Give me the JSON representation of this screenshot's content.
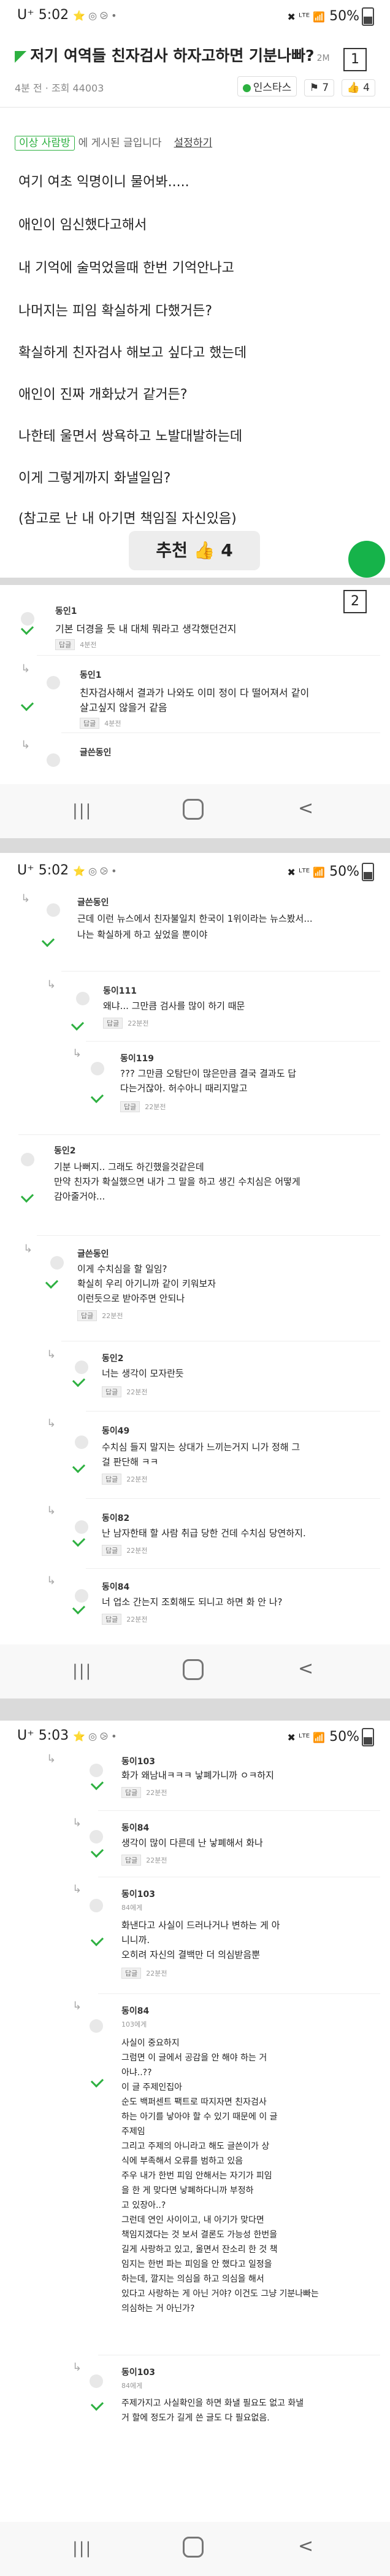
{
  "status_bar": {
    "carrier": "U⁺",
    "time1": "5:02",
    "time2": "5:02",
    "time3": "5:03",
    "icons": "⭐ ◎ ⧁ •",
    "right": "✖ ᴸᵀᴱ 📶",
    "battery": "50%"
  },
  "nav": {
    "recent": "|||",
    "home": "home",
    "back": "<"
  },
  "post": {
    "category_icon": "◤",
    "title": "저기 여역들 친자검사 하자고하면 기분나빠?",
    "title_small": "2M",
    "meta": "4분 전 · 조회 44003",
    "badge": "인스타스",
    "bookmarks": "7",
    "likes": "4",
    "notice_tag": "이상 사람방",
    "notice_text": "에 게시된 글입니다",
    "notice_link": "설정하기",
    "body": [
      "여기 여초 익명이니 물어봐.....",
      "애인이 임신했다고해서",
      "내 기억에 술먹었을때 한번 기억안나고",
      "나머지는 피임 확실하게 다했거든?",
      "확실하게 친자검사 해보고 싶다고 했는데",
      "애인이 진짜 개화났거 같거든?",
      "나한테 울면서 쌍욕하고 노발대발하는데",
      "이게 그렇게까지 화낼일임?",
      "(참고로 난 내 아기면 책임질 자신있음)"
    ],
    "recommend": "추천 👍 4"
  },
  "markers": {
    "one": "1",
    "two": "2"
  },
  "comments": [
    {
      "name": "동인1",
      "lines": [
        "기본 더경을 듯 내 대체 뭐라고 생각했던건지"
      ],
      "time": "4분전",
      "reply": "답글"
    },
    {
      "name": "동인1",
      "lines": [
        "친자검사해서 결과가 나와도 이미 정이 다 떨어져서 같이",
        "살고싶지 않을거 같음"
      ],
      "time": "4분전",
      "reply": "답글"
    },
    {
      "name": "글쓴동인",
      "lines": [],
      "time": "",
      "reply": ""
    },
    {
      "name": "글쓴동인",
      "lines": [
        "근데 이런 뉴스에서 친자불일치 한국이 1위이라는 뉴스봤서...",
        "나는 확실하게 하고 싶었을 뿐이야"
      ],
      "time": "",
      "reply": ""
    },
    {
      "name": "동이111",
      "lines": [
        "왜냐... 그만큼 검사를 많이 하기 때문"
      ],
      "time": "22분전",
      "reply": "답글"
    },
    {
      "name": "동이119",
      "lines": [
        "??? 그만큼 오탐단이 많은만큼 결국 결과도 답",
        "다는거잖아. 허수아니 때리지말고"
      ],
      "time": "22분전",
      "reply": "답글"
    },
    {
      "name": "동인2",
      "lines": [
        "기분 나뻐지.. 그래도 하긴했을것같은데",
        "만약 친자가 확실했으면 내가 그 말을 하고 생긴 수치심은 어떻게",
        "감아줄거야..."
      ],
      "time": "",
      "reply": ""
    },
    {
      "name": "글쓴동인",
      "lines": [
        "이게 수치심을 할 일임?",
        "확실히 우리 아기니까 같이 키워보자",
        "이런듯으로 받아주면 안되나"
      ],
      "time": "22분전",
      "reply": "답글"
    },
    {
      "name": "동인2",
      "lines": [
        "너는 생각이 모자란듯"
      ],
      "time": "22분전",
      "reply": "답글"
    },
    {
      "name": "동이49",
      "lines": [
        "수치심 들지 말지는 상대가 느끼는거지 니가 정해 그",
        "걸 판단해 ㅋㅋ"
      ],
      "time": "22분전",
      "reply": "답글"
    },
    {
      "name": "동이82",
      "lines": [
        "난 남자한태 할 사람 취급 당한 건데 수치심 당연하지."
      ],
      "time": "22분전",
      "reply": "답글"
    },
    {
      "name": "동이84",
      "lines": [
        "너 업소 간는지 조회해도 되니고 하면 화 안 나?"
      ],
      "time": "22분전",
      "reply": "답글"
    },
    {
      "name": "동이103",
      "lines": [
        "화가 왜남내ㅋㅋㅋ 낳폐가니까 ㅇㅋ하지"
      ],
      "time": "22분전",
      "reply": "답글"
    },
    {
      "name": "동이84",
      "lines": [
        "생각이 많이 다른데 난 낳폐해서 화나"
      ],
      "time": "22분전",
      "reply": "답글"
    },
    {
      "name": "동이103",
      "sub": "84에게",
      "lines": [
        "화낸다고 사실이 드러나거나 변하는 게 아",
        "니니까.",
        "오히려 자신의 결백만 더 의심받음뿐"
      ],
      "time": "22분전",
      "reply": "답글"
    },
    {
      "name": "동이84",
      "sub": "103에게",
      "lines": [
        "사실이 중요하지",
        "그럼면 이 글에서 공감을 안 해야 하는 거",
        "아냐..??",
        "이 글 주제인집아",
        "순도 백퍼센트 팩트로 따지자면 친자검사",
        "하는 아기를 낳아야 할 수 있기 때문에 이 글",
        "주제임",
        "그리고 주제의 아니라고 해도 글쓴이가 상",
        "식에 부족해서 오류를 범하고 있음",
        "주우 내가 한번 피임 안해서는 자기가 피임",
        "을 한 게 맞다면 낳폐하다니까 부정하",
        "고 있장아..?",
        "그런데 연인 사이이고, 내 아기가 맞다면",
        "책임지겠다는 것 보서 결론도 가능성 한번을",
        "길게 사랑하고 있고, 울면서 잔소리 한 것 책",
        "임지는 한번 파는 피임을 안 했다고 일정을",
        "하는데, 깔지는 의심을 하고 의심을 해서",
        "있다고 사랑하는 게 아닌 거야? 이건도 그냥 기분나빠는",
        "의심하는 거 아닌가?"
      ],
      "time": "",
      "reply": ""
    },
    {
      "name": "동이103",
      "sub": "84에게",
      "lines": [
        "주제가지고 사실확인을 하면 화낼 필요도 없고 화낼",
        "거 할에 정도가 길게 쓴 글도 다 필요없음."
      ],
      "time": "",
      "reply": ""
    }
  ]
}
